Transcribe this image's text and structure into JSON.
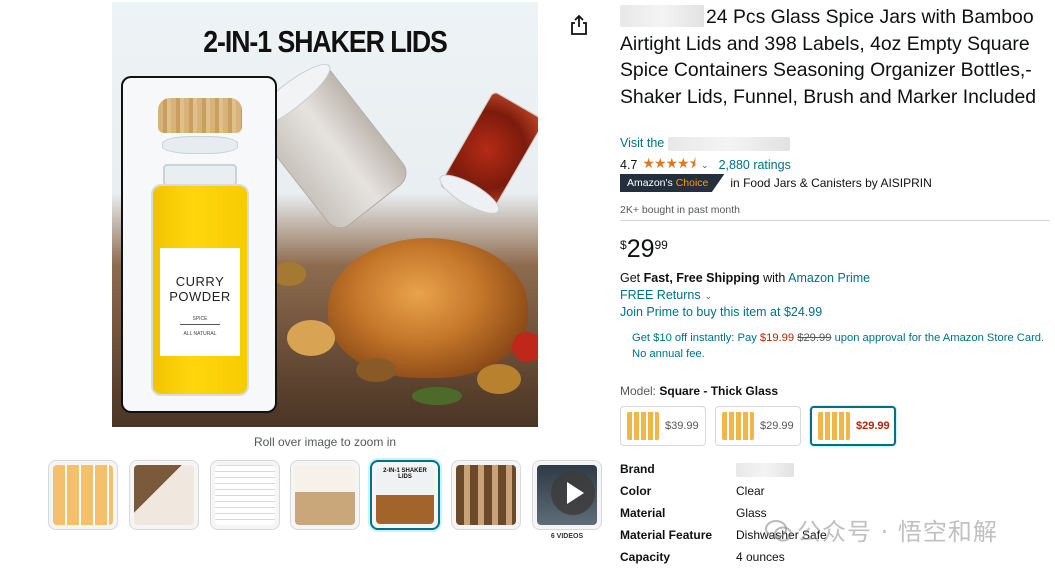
{
  "gallery": {
    "banner": "2-IN-1 SHAKER LIDS",
    "jar_label": {
      "line1": "CURRY",
      "line2": "POWDER",
      "line3": "SPICE",
      "line4": "ALL NATURAL"
    },
    "zoom_hint": "Roll over image to zoom in",
    "thumbnails": [
      {
        "name": "thumb-1",
        "selected": false
      },
      {
        "name": "thumb-2",
        "selected": false
      },
      {
        "name": "thumb-3",
        "selected": false
      },
      {
        "name": "thumb-4",
        "selected": false
      },
      {
        "name": "thumb-5",
        "selected": true,
        "text": "2-IN-1 SHAKER LIDS"
      },
      {
        "name": "thumb-6",
        "selected": false
      },
      {
        "name": "thumb-video",
        "selected": false
      }
    ],
    "video_caption": "6 VIDEOS"
  },
  "product": {
    "title": "24 Pcs Glass Spice Jars with Bamboo Airtight Lids and 398 Labels, 4oz Empty Square Spice Containers Seasoning Organizer Bottles,-Shaker Lids, Funnel, Brush and Marker Included",
    "visit_prefix": "Visit the",
    "rating_value": "4.7",
    "stars": "★★★★⯨",
    "ratings_count": "2,880 ratings",
    "badge": {
      "prefix": "Amazon's",
      "highlight": "Choice"
    },
    "badge_category": "in Food Jars & Canisters by AISIPRIN",
    "bought": "2K+ bought in past month",
    "price": {
      "symbol": "$",
      "whole": "29",
      "fraction": "99"
    },
    "shipping": {
      "prefix": "Get",
      "bold": "Fast, Free Shipping",
      "with": "with",
      "link": "Amazon Prime"
    },
    "returns": "FREE Returns",
    "prime_buy": "Join Prime to buy this item at $24.99",
    "card_offer": {
      "part1": "Get $10 off instantly: Pay",
      "price": "$19.99",
      "strike": "$29.99",
      "part2": "upon approval for the Amazon Store Card. No annual fee."
    },
    "model": {
      "label": "Model:",
      "value": "Square - Thick Glass"
    },
    "options": [
      {
        "price": "$39.99",
        "selected": false
      },
      {
        "price": "$29.99",
        "selected": false
      },
      {
        "price": "$29.99",
        "selected": true
      }
    ],
    "specs": [
      {
        "key": "Brand",
        "value": ""
      },
      {
        "key": "Color",
        "value": "Clear"
      },
      {
        "key": "Material",
        "value": "Glass"
      },
      {
        "key": "Material Feature",
        "value": "Dishwasher Safe"
      },
      {
        "key": "Capacity",
        "value": "4 ounces"
      }
    ]
  },
  "watermark": "公众号 · 悟空和解",
  "colors": {
    "link": "#007185",
    "price_red": "#b12704",
    "star": "#de7921",
    "badge_bg": "#232f3e",
    "badge_orange": "#ff9900"
  },
  "icons": {
    "share": "share-icon",
    "play": "play-icon",
    "chevron": "chevron-down-icon"
  }
}
